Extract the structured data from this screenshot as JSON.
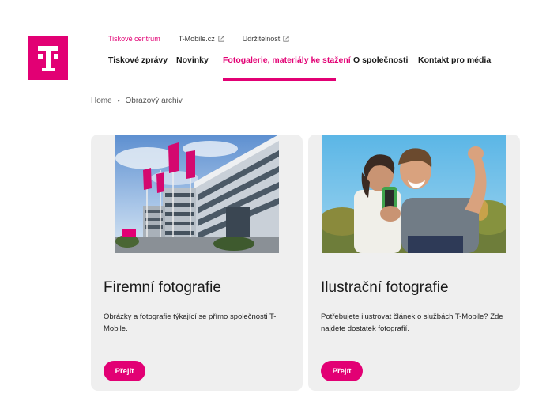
{
  "brand": {
    "logo_letter": "T",
    "color": "#e20074"
  },
  "top_nav": [
    {
      "label": "Tiskové centrum",
      "external": false,
      "active": true
    },
    {
      "label": "T-Mobile.cz",
      "external": true,
      "active": false
    },
    {
      "label": "Udržitelnost",
      "external": true,
      "active": false
    }
  ],
  "main_nav": [
    {
      "label": "Tiskové zprávy",
      "active": false
    },
    {
      "label": "Novinky",
      "active": false
    },
    {
      "label": "Fotogalerie, materiály ke stažení",
      "active": true
    },
    {
      "label": "O společnosti",
      "active": false
    },
    {
      "label": "Kontakt pro média",
      "active": false
    }
  ],
  "breadcrumb": {
    "home": "Home",
    "current": "Obrazový archiv"
  },
  "cards": [
    {
      "title": "Firemní fotografie",
      "description": "Obrázky a fotografie týkající se přímo společnosti T-Mobile.",
      "button": "Přejít",
      "image": "office-building-with-magenta-flags"
    },
    {
      "title": "Ilustrační fotografie",
      "description": "Potřebujete ilustrovat článek o službách T-Mobile? Zde najdete dostatek fotografií.",
      "button": "Přejít",
      "image": "two-young-men-smiling-at-phone"
    }
  ]
}
